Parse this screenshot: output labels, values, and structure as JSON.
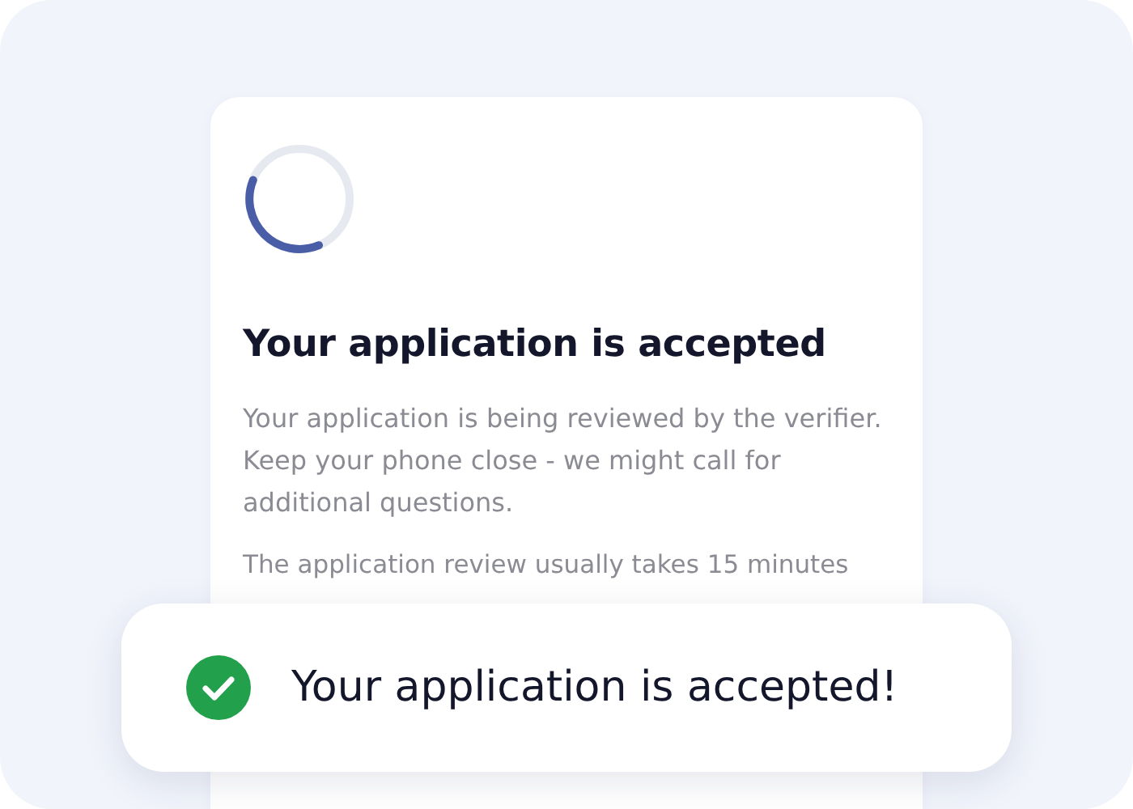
{
  "card": {
    "title": "Your application is accepted",
    "paragraphs": [
      "Your application is being reviewed by the verifier. Keep your phone close - we might call for additional questions.",
      "The application review usually takes 15 minutes"
    ]
  },
  "toast": {
    "message": "Your application is accepted!"
  }
}
